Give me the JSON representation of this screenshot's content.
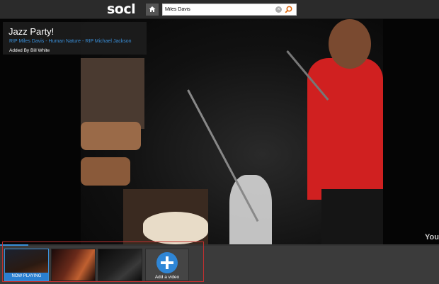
{
  "header": {
    "logo": "socl",
    "search_value": "Miles Davis"
  },
  "video": {
    "title": "Jazz Party!",
    "tags": [
      "RIP Miles Davis",
      "Human Nature",
      "RIP Michael Jackson"
    ],
    "tag_separator": "-",
    "added_by": "Added By Bill White",
    "watermark": "You",
    "progress": 0.065
  },
  "playlist": {
    "now_playing_label": "NOW PLAYING",
    "add_label": "Add a video"
  },
  "colors": {
    "accent": "#2f86d6",
    "link": "#3a8fd9",
    "topbar": "#2b2b2b",
    "strip": "#3b3b3b",
    "highlight_outline": "#c03030"
  }
}
